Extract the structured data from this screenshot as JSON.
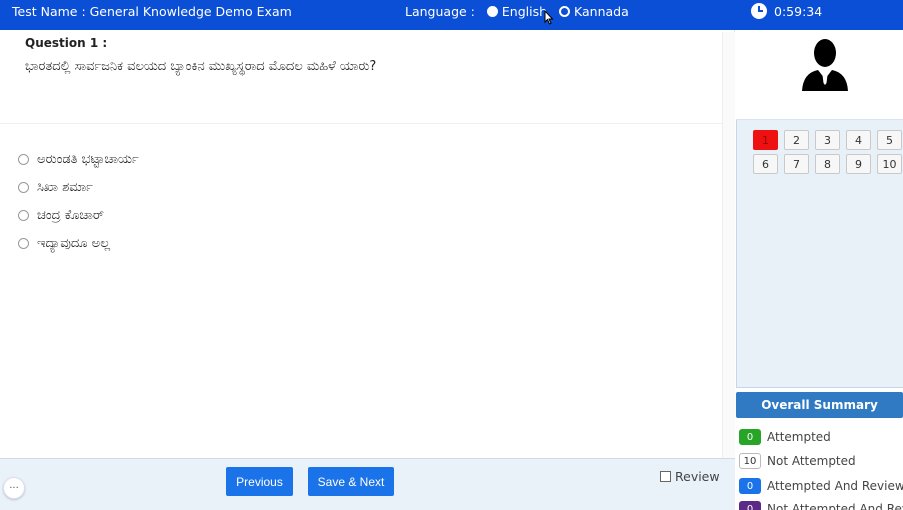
{
  "header": {
    "test_name": "Test Name : General Knowledge Demo Exam",
    "language_label": "Language :",
    "languages": [
      "English",
      "Kannada"
    ],
    "timer": "0:59:34"
  },
  "question": {
    "number": "Question 1 :",
    "text": "ಭಾರತದಲ್ಲಿ ಸಾರ್ವಜನಿಕ ವಲಯದ ಬ್ಯಾಂಕಿನ ಮುಖ್ಯಸ್ಥರಾದ ಮೊದಲ ಮಹಿಳೆ ಯಾರು?",
    "options": [
      "ಅರುಂಡತಿ ಭಟ್ಟಾಚಾರ್ಯ",
      "ಸಿಖಾ ಶರ್ಮಾ",
      "ಚಂದ್ರ ಕೊಚಾರ್",
      "ಇದ್ಯಾವುದೂ ಅಲ್ಲ"
    ]
  },
  "footer": {
    "previous": "Previous",
    "save_next": "Save & Next",
    "review": "Review",
    "chat": "···"
  },
  "palette": {
    "questions": [
      "1",
      "2",
      "3",
      "4",
      "5",
      "6",
      "7",
      "8",
      "9",
      "10"
    ],
    "current": "1"
  },
  "summary": {
    "title": "Overall Summary",
    "items": [
      {
        "count": "0",
        "label": "Attempted"
      },
      {
        "count": "10",
        "label": "Not Attempted"
      },
      {
        "count": "0",
        "label": "Attempted And Review"
      },
      {
        "count": "0",
        "label": "Not Attempted And Review"
      }
    ]
  },
  "colors": {
    "header": "#0a4fd6",
    "button": "#1a73e8",
    "current_question": "#ee1111",
    "summary_head": "#2f7ac2"
  }
}
